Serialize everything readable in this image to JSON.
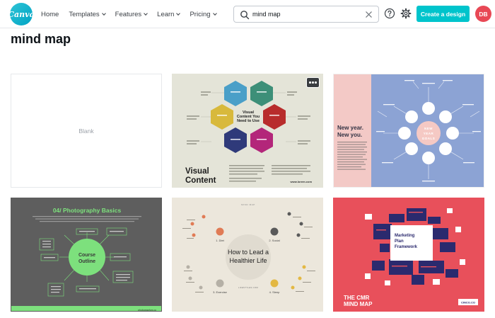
{
  "header": {
    "logo_text": "Canva",
    "nav": [
      {
        "label": "Home",
        "dropdown": false
      },
      {
        "label": "Templates",
        "dropdown": true
      },
      {
        "label": "Features",
        "dropdown": true
      },
      {
        "label": "Learn",
        "dropdown": true
      },
      {
        "label": "Pricing",
        "dropdown": true
      }
    ],
    "search_value": "mind map",
    "create_label": "Create a design",
    "avatar_initials": "DB"
  },
  "page_title": "mind map",
  "cards": {
    "blank": {
      "label": "Blank"
    },
    "visual": {
      "title_line1": "Visual",
      "title_line2": "Content",
      "center_line1": "Visual",
      "center_line2": "Content You",
      "center_line3": "Need to Use",
      "url": "www.lorem.com"
    },
    "goals": {
      "heading_line1": "New year.",
      "heading_line2": "New you.",
      "center_line1": "NEW",
      "center_line2": "YEAR",
      "center_line3": "GOALS"
    },
    "photo": {
      "title": "04/ Photography Basics",
      "center_line1": "Course",
      "center_line2": "Outline",
      "footer": "photographyx.co"
    },
    "life": {
      "tag": "MIND MAP",
      "title_line1": "How to Lead a",
      "title_line2": "Healthier Life",
      "n1": "1. Diet",
      "n2": "2. Social",
      "n3": "3. Exercise",
      "n4": "4. Sleep",
      "url": "LIFESTYLES.COM"
    },
    "cmr": {
      "center_line1": "Marketing",
      "center_line2": "Plan",
      "center_line3": "Framework",
      "title_line1": "THE CMR",
      "title_line2": "MIND MAP",
      "brand": "CINCO.CO"
    }
  },
  "colors": {
    "accent": "#00c4cc",
    "avatar": "#e84855"
  }
}
